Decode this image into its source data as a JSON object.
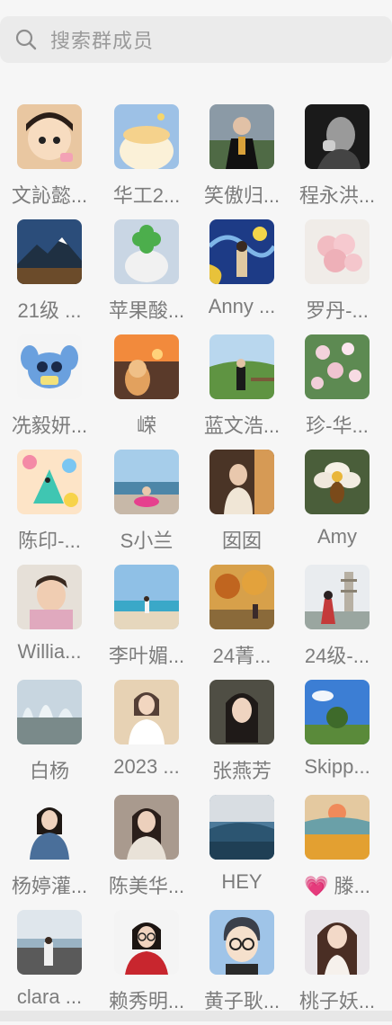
{
  "search": {
    "placeholder": "搜索群成员",
    "icon": "search-icon"
  },
  "members": [
    {
      "name": "文訫懿...",
      "avatar": "cartoon-boy"
    },
    {
      "name": "华工2...",
      "avatar": "cake"
    },
    {
      "name": "笑傲归...",
      "avatar": "graduate"
    },
    {
      "name": "程永洪...",
      "avatar": "bw-portrait"
    },
    {
      "name": "21级 ...",
      "avatar": "mountain"
    },
    {
      "name": "苹果酸...",
      "avatar": "clover-plush"
    },
    {
      "name": "Anny ...",
      "avatar": "starry-night"
    },
    {
      "name": "罗丹-...",
      "avatar": "roses"
    },
    {
      "name": "冼毅妍...",
      "avatar": "stitch"
    },
    {
      "name": "嵘",
      "avatar": "sunset-dog"
    },
    {
      "name": "蓝文浩...",
      "avatar": "green-hill"
    },
    {
      "name": "珍-华...",
      "avatar": "flowers"
    },
    {
      "name": "陈印-...",
      "avatar": "colorful-creature"
    },
    {
      "name": "S小兰",
      "avatar": "seaside"
    },
    {
      "name": "囡囡",
      "avatar": "girl-warm"
    },
    {
      "name": "Amy",
      "avatar": "bee-flower"
    },
    {
      "name": "Willia...",
      "avatar": "baby"
    },
    {
      "name": "李叶媚...",
      "avatar": "beach"
    },
    {
      "name": "24菁...",
      "avatar": "autumn-trees"
    },
    {
      "name": "24级-...",
      "avatar": "pagoda"
    },
    {
      "name": "白杨",
      "avatar": "fountain"
    },
    {
      "name": "2023 ...",
      "avatar": "woman-white"
    },
    {
      "name": "张燕芳",
      "avatar": "woman-dark"
    },
    {
      "name": "Skipp...",
      "avatar": "blue-sky"
    },
    {
      "name": "杨婷灌...",
      "avatar": "woman-denim"
    },
    {
      "name": "陈美华...",
      "avatar": "woman-sofa"
    },
    {
      "name": "HEY",
      "avatar": "blue-landscape"
    },
    {
      "name": "💗 滕...",
      "avatar": "wheat-field"
    },
    {
      "name": "clara ...",
      "avatar": "lake-girl"
    },
    {
      "name": "赖秀明...",
      "avatar": "woman-glasses"
    },
    {
      "name": "黄子耿...",
      "avatar": "cartoon-glasses"
    },
    {
      "name": "桃子妖...",
      "avatar": "woman-hair"
    }
  ]
}
